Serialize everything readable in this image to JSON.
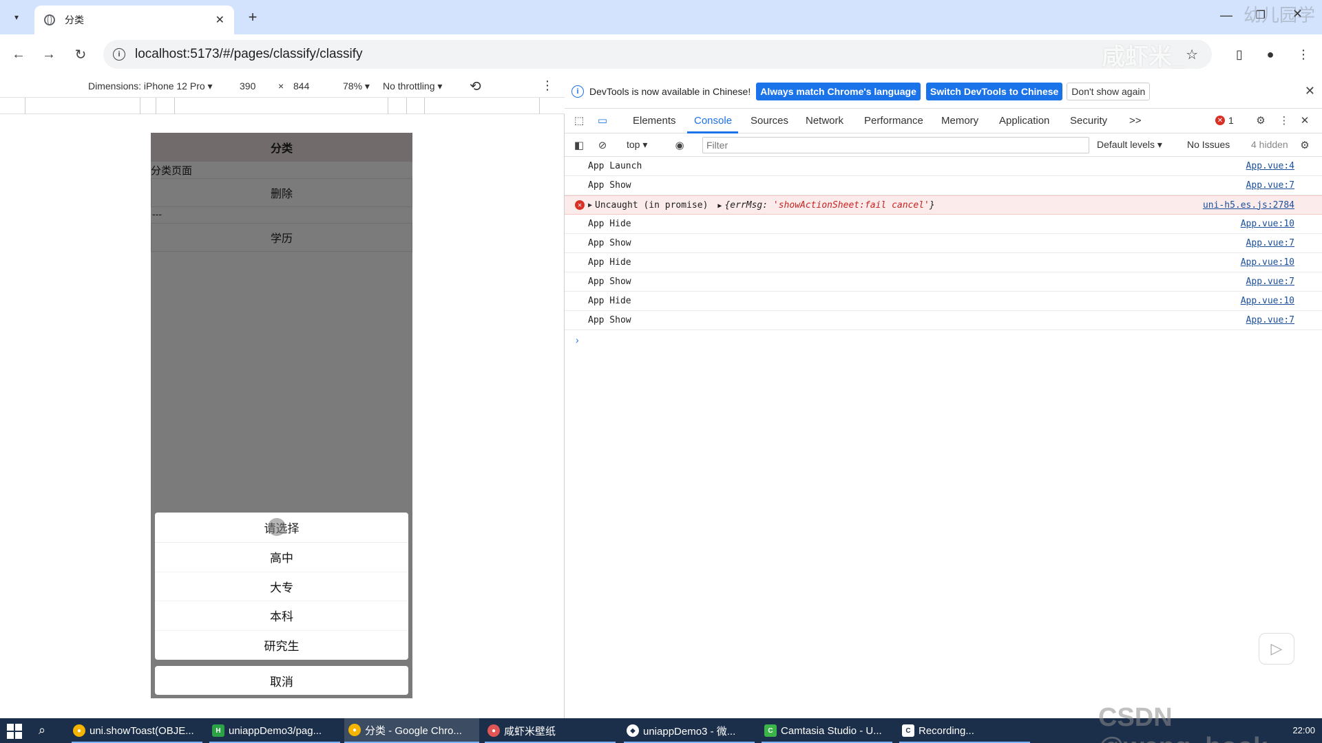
{
  "browser": {
    "tab_title": "分类",
    "url": "localhost:5173/#/pages/classify/classify",
    "watermark_top": "幼儿园学",
    "watermark_omnibox": "咸虾米_"
  },
  "emulation": {
    "dimensions_label": "Dimensions: iPhone 12 Pro",
    "width": "390",
    "times": "×",
    "height": "844",
    "zoom": "78%",
    "throttling": "No throttling"
  },
  "phone": {
    "nav_title": "分类",
    "page_text": "分类页面",
    "delete_button": "删除",
    "separator": "---",
    "education_button": "学历",
    "action_sheet": {
      "title": "请选择",
      "items": [
        "高中",
        "大专",
        "本科",
        "研究生"
      ],
      "cancel": "取消"
    }
  },
  "devtools": {
    "info_text": "DevTools is now available in Chinese!",
    "btn_match": "Always match Chrome's language",
    "btn_switch": "Switch DevTools to Chinese",
    "btn_dont_show": "Don't show again",
    "tabs": [
      "Elements",
      "Console",
      "Sources",
      "Network",
      "Performance",
      "Memory",
      "Application",
      "Security"
    ],
    "more_tabs": ">>",
    "error_count": "1",
    "context": "top",
    "filter_placeholder": "Filter",
    "default_levels": "Default levels",
    "no_issues": "No Issues",
    "hidden": "4 hidden",
    "console_rows": [
      {
        "text": "App Launch",
        "src": "App.vue:4"
      },
      {
        "text": "App Show",
        "src": "App.vue:7"
      },
      {
        "text": "Uncaught (in promise)",
        "obj_key": "{errMsg: ",
        "obj_val": "'showActionSheet:fail cancel'",
        "obj_end": "}",
        "src": "uni-h5.es.js:2784",
        "error": true
      },
      {
        "text": "App Hide",
        "src": "App.vue:10"
      },
      {
        "text": "App Show",
        "src": "App.vue:7"
      },
      {
        "text": "App Hide",
        "src": "App.vue:10"
      },
      {
        "text": "App Show",
        "src": "App.vue:7"
      },
      {
        "text": "App Hide",
        "src": "App.vue:10"
      },
      {
        "text": "App Show",
        "src": "App.vue:7"
      }
    ]
  },
  "taskbar": {
    "items": [
      "uni.showToast(OBJE...",
      "uniappDemo3/pag...",
      "分类 - Google Chro...",
      "咸虾米壁纸",
      "uniappDemo3 - 微...",
      "Camtasia Studio - U...",
      "Recording..."
    ],
    "time": "22:00",
    "watermark": "CSDN @wang_book"
  }
}
